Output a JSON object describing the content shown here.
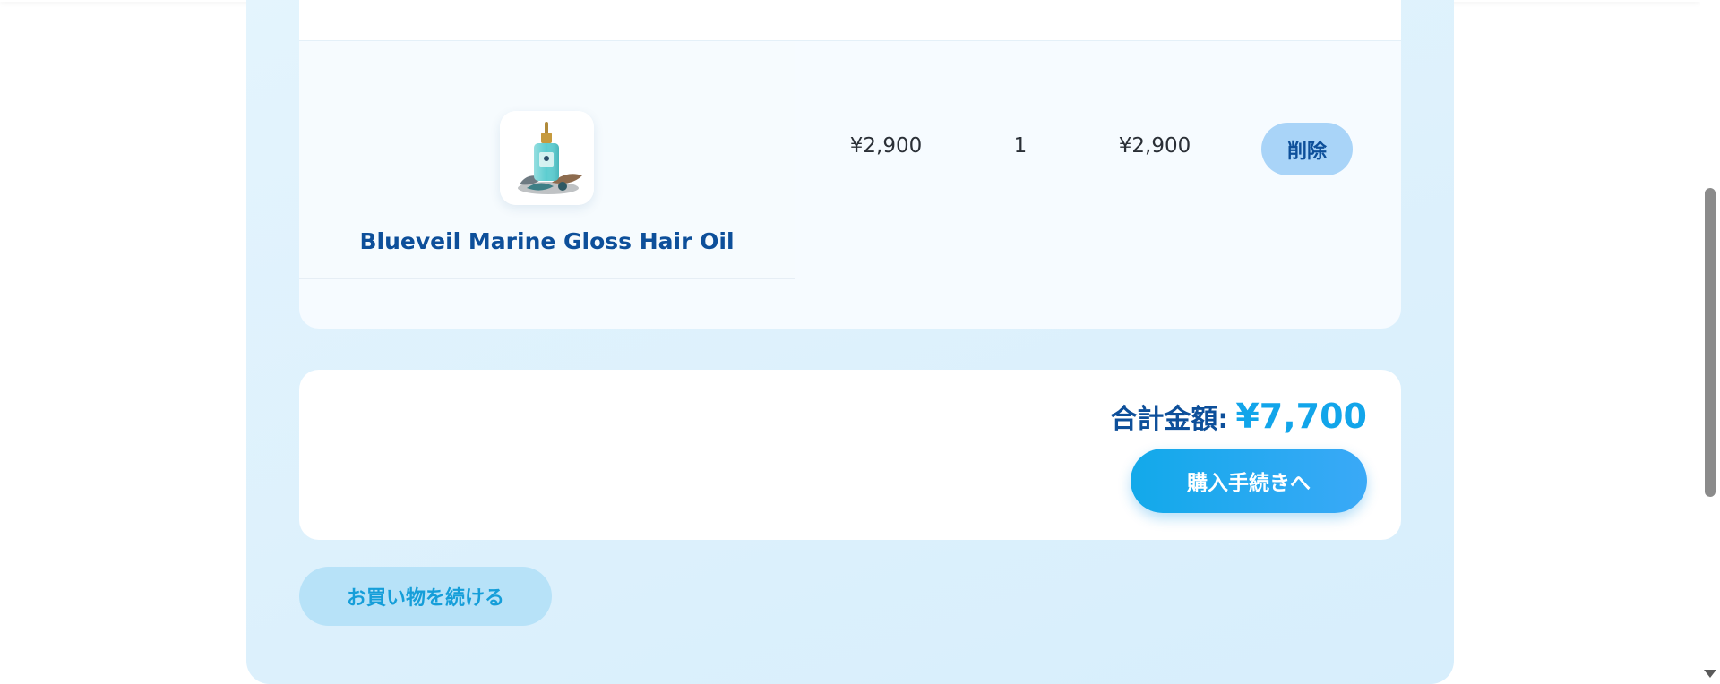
{
  "cart": {
    "items": [
      {
        "name": "Blueveil Marine Gloss Hair Oil",
        "price": "¥2,900",
        "quantity": "1",
        "subtotal": "¥2,900",
        "delete_label": "削除",
        "image_icon": "hair-oil-bottle-image"
      }
    ]
  },
  "summary": {
    "total_label": "合計金額:",
    "total_value": "¥7,700",
    "checkout_label": "購入手続きへ"
  },
  "continue_shopping_label": "お買い物を続ける",
  "colors": {
    "brand_dark": "#0d4f9a",
    "accent": "#12a5ea",
    "panel_bg": "#dff1fc",
    "delete_bg": "#a9d4f8",
    "continue_bg": "#b7e2f8"
  }
}
